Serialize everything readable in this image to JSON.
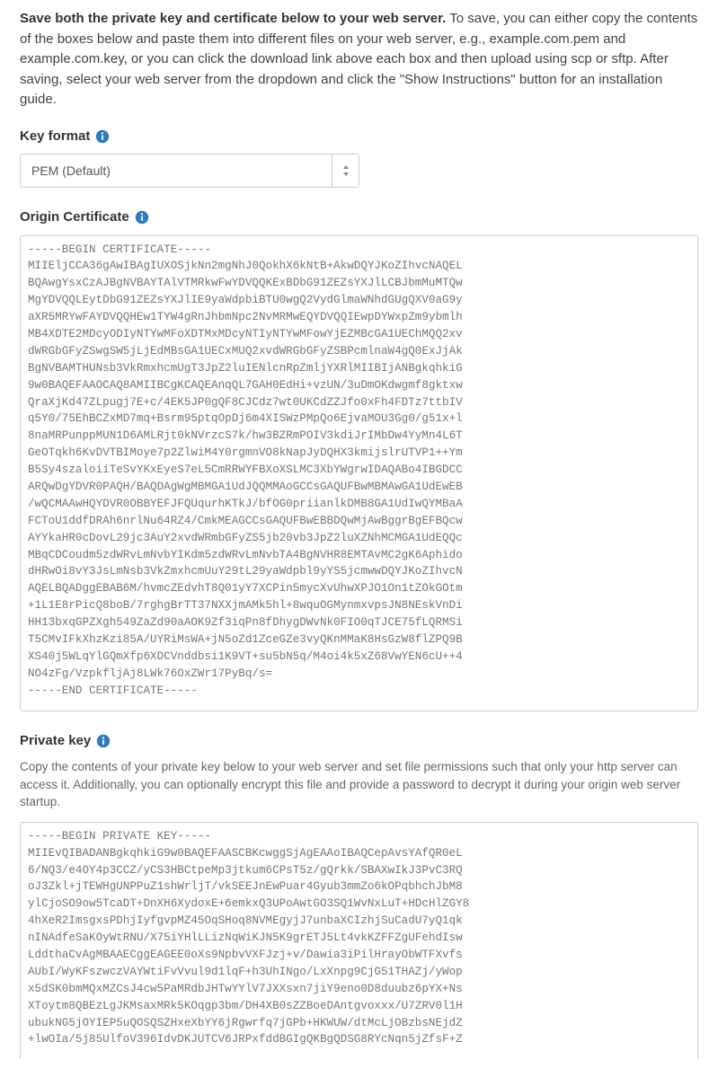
{
  "intro": {
    "bold": "Save both the private key and certificate below to your web server.",
    "rest": " To save, you can either copy the contents of the boxes below and paste them into different files on your web server, e.g., example.com.pem and example.com.key, or you can click the download link above each box and then upload using scp or sftp. After saving, select your web server from the dropdown and click the \"Show Instructions\" button for an installation guide."
  },
  "keyFormat": {
    "label": "Key format",
    "value": "PEM (Default)"
  },
  "originCert": {
    "label": "Origin Certificate",
    "content": "-----BEGIN CERTIFICATE-----\nMIIEljCCA36gAwIBAgIUXOSjkNn2mgNhJ0QokhX6kNtB+AkwDQYJKoZIhvcNAQEL\nBQAwgYsxCzAJBgNVBAYTAlVTMRkwFwYDVQQKExBDbG91ZEZsYXJlLCBJbmMuMTQw\nMgYDVQQLEytDbG91ZEZsYXJlIE9yaWdpbiBTU0wgQ2VydGlmaWNhdGUgQXV0aG9y\naXR5MRYwFAYDVQQHEw1TYW4gRnJhbmNpc2NvMRMwEQYDVQQIEwpDYWxpZm9ybmlh\nMB4XDTE2MDcyODIyNTYwMFoXDTMxMDcyNTIyNTYwMFowYjEZMBcGA1UEChMQQ2xv\ndWRGbGFyZSwgSW5jLjEdMBsGA1UECxMUQ2xvdWRGbGFyZSBPcmlnaW4gQ0ExJjAk\nBgNVBAMTHUNsb3VkRmxhcmUgT3JpZ2luIENlcnRpZmljYXRlMIIBIjANBgkqhkiG\n9w0BAQEFAAOCAQ8AMIIBCgKCAQEAnqQL7GAH0EdHi+vzUN/3uDmOKdwgmf8gktxw\nQraXjKd47ZLpugj7E+c/4EK5JP0gQF8CJCdz7wt0UKCdZZJfo0xFh4FDTz7ttbIV\nq5Y0/75EhBCZxMD7mq+Bsrm95ptqOpDj6m4XISWzPMpQo6EjvaMOU3Gg0/g51x+l\n8naMRPunppMUN1D6AMLRjt0kNVrzcS7k/hw3BZRmPOIV3kdiJrIMbDw4YyMn4L6T\nGeOTqkh6KvDVTBIMoye7p2ZlwiM4Y0rgmnVO8kNapJyDQHX3kmijslrUTVP1++Ym\nB5Sy4szaloiiTeSvYKxEyeS7eL5CmRRWYFBXoXSLMC3XbYWgrwIDAQABo4IBGDCC\nARQwDgYDVR0PAQH/BAQDAgWgMBMGA1UdJQQMMAoGCCsGAQUFBwMBMAwGA1UdEwEB\n/wQCMAAwHQYDVR0OBBYEFJFQUqurhKTkJ/bfOG0priianlkDMB8GA1UdIwQYMBaA\nFCToU1ddfDRAh6nrlNu64RZ4/CmkMEAGCCsGAQUFBwEBBDQwMjAwBggrBgEFBQcw\nAYYkaHR0cDovL29jc3AuY2xvdWRmbGFyZS5jb20vb3JpZ2luXZNhMCMGA1UdEQQc\nMBqCDCoudm5zdWRvLmNvbYIKdm5zdWRvLmNvbTA4BgNVHR8EMTAvMC2gK6Aphido\ndHRwOi8vY3JsLmNsb3VkZmxhcmUuY29tL29yaWdpbl9yYS5jcmwwDQYJKoZIhvcN\nAQELBQADggEBAB6M/hvmcZEdvhT8Q01yY7XCPin5mycXvUhwXPJO1On1tZOkGOtm\n+1L1E8rPicQ8boB/7rghgBrTT37NXXjmAMk5hl+8wquOGMynmxvpsJN8NEskVnDi\nHH13bxqGPZXgh549ZaZd90aAOK9Zf3iqPn8fDhygDWvNk0FIO0qTJCE75fLQRMSi\nT5CMvIFkXhzKzi85A/UYRiMsWA+jN5oZd1ZceGZe3vyQKnMMaK8HsGzW8flZPQ9B\nXS40j5WLqYlGQmXfp6XDCVnddbsi1K9VT+su5bN5q/M4oi4k5xZ68VwYEN6cU++4\nNO4zFg/VzpkfljAj8LWk76OxZWr17PyBq/s=\n-----END CERTIFICATE-----"
  },
  "privateKey": {
    "label": "Private key",
    "help": "Copy the contents of your private key below to your web server and set file permissions such that only your http server can access it. Additionally, you can optionally encrypt this file and provide a password to decrypt it during your origin web server startup.",
    "content": "-----BEGIN PRIVATE KEY-----\nMIIEvQIBADANBgkqhkiG9w0BAQEFAASCBKcwggSjAgEAAoIBAQCepAvsYAfQR0eL\n6/NQ3/e4OY4p3CCZ/yCS3HBCtpeMp3jtkum6CPsT5z/gQrkk/SBAXwIkJ3PvC3RQ\noJ3Zkl+jTEWHgUNPPuZ1shWrljT/vkSEEJnEwPuar4Gyub3mmZo6kOPqbhchJbM8\nylCjoSO9ow5TcaDT+DnXH6XydoxE+6emkxQ3UPoAwtGO3SQ1WvNxLuT+HDcHlZGY8\n4hXeR2ImsgxsPDhjIyfgvpMZ45OqSHoq8NVMEgyjJ7unbaXCIzhjSuCadU7yQ1qk\nnINAdfeSaKOyWtRNU/X75iYHlLLizNqWiKJN5K9grETJ5Lt4vkKZFFZgUFehdIsw\nLddthaCvAgMBAAECggEAGEE0oXs9NpbvVXFJzj+v/Dawia3iPilHrayObWTFXvfs\nAUbI/WyKFszwczVAYWtiFvVvul9d1lqF+h3UhINgo/LxXnpg9CjG51THAZj/yWop\nx5dSK0bmMQxMZCsJ4cw5PaMRdbJHTwYYlV7JXXsxn7jiY9eno0D8duubz6pYX+Ns\nXToytm8QBEzLgJKMsaxMRk5KOqgp3bm/DH4XB0sZZBoeDAntgvoxxx/U7ZRV0l1H\nubukNG5jOYIEP5uQOSQSZHxeXbYY6jRgwrfq7jGPb+HKWUW/dtMcLjOBzbsNEjdZ\n+lwOIa/5j85UlfoV396IdvDKJUTCV6JRPxfddBGIgQKBgQDSG8RYcNqn5jZfsF+Z"
  }
}
